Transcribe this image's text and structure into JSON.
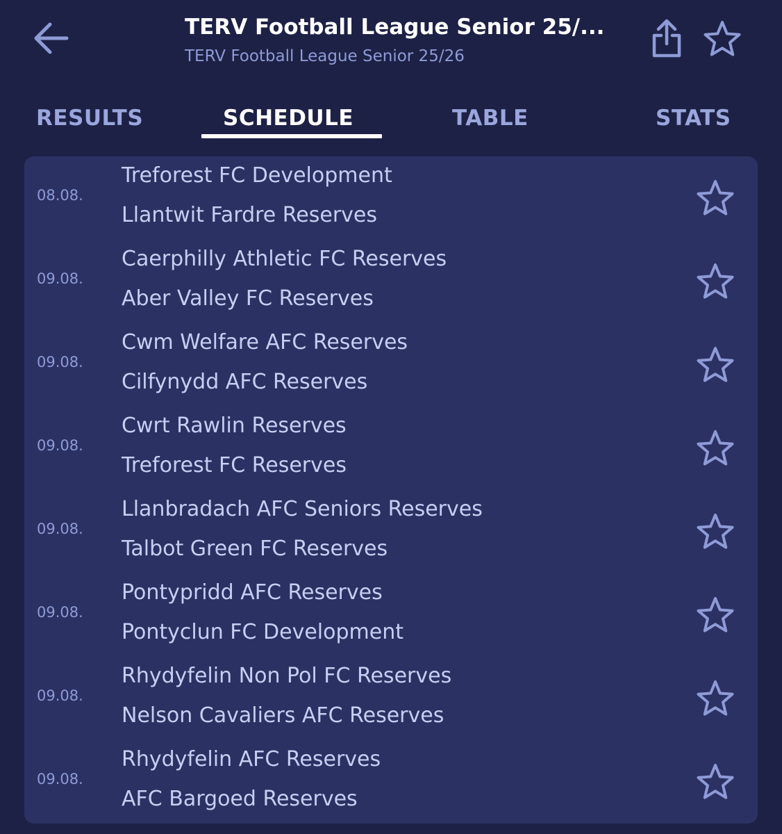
{
  "header": {
    "title": "TERV Football League Senior 25/...",
    "subtitle": "TERV Football League Senior 25/26",
    "back_icon": "arrow-left-icon",
    "share_icon": "share-icon",
    "favorite_icon": "star-outline-icon"
  },
  "tabs": [
    {
      "label": "RESULTS",
      "active": false
    },
    {
      "label": "SCHEDULE",
      "active": true
    },
    {
      "label": "TABLE",
      "active": false
    },
    {
      "label": "STATS",
      "active": false
    }
  ],
  "matches": [
    {
      "date": "08.08.",
      "home": "Treforest FC Development",
      "away": "Llantwit Fardre Reserves"
    },
    {
      "date": "09.08.",
      "home": "Caerphilly Athletic FC Reserves",
      "away": "Aber Valley FC Reserves"
    },
    {
      "date": "09.08.",
      "home": "Cwm Welfare AFC Reserves",
      "away": "Cilfynydd AFC Reserves"
    },
    {
      "date": "09.08.",
      "home": "Cwrt Rawlin Reserves",
      "away": "Treforest FC Reserves"
    },
    {
      "date": "09.08.",
      "home": "Llanbradach AFC Seniors Reserves",
      "away": "Talbot Green FC Reserves"
    },
    {
      "date": "09.08.",
      "home": "Pontypridd AFC Reserves",
      "away": "Pontyclun FC Development"
    },
    {
      "date": "09.08.",
      "home": "Rhydyfelin Non Pol FC Reserves",
      "away": "Nelson Cavaliers AFC Reserves"
    },
    {
      "date": "09.08.",
      "home": "Rhydyfelin AFC Reserves",
      "away": "AFC Bargoed Reserves"
    }
  ],
  "colors": {
    "background": "#1d2145",
    "card": "#2c3163",
    "divider": "#1d2145",
    "accent": "#8e9bd6",
    "tab_inactive": "#9aa6dc",
    "text": "#c6cff2"
  }
}
